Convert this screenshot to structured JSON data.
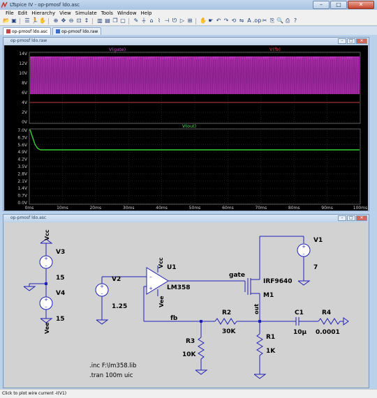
{
  "window": {
    "title": "LTspice IV - op-pmosf ldo.asc",
    "minimize": "–",
    "maximize": "□",
    "close": "✕"
  },
  "menu": [
    "File",
    "Edit",
    "Hierarchy",
    "View",
    "Simulate",
    "Tools",
    "Window",
    "Help"
  ],
  "toolbar_icons": [
    "open-icon",
    "save-icon",
    "control-panel-icon",
    "run-icon",
    "halt-icon",
    "zoom-in-icon",
    "pan-icon",
    "zoom-out-icon",
    "zoom-full-icon",
    "autorange-icon",
    "tile-vert-icon",
    "tile-horiz-icon",
    "cascade-icon",
    "close-window-icon",
    "wire-icon",
    "ground-icon",
    "label-icon",
    "resistor-icon",
    "capacitor-icon",
    "inductor-icon",
    "diode-icon",
    "component-icon",
    "move-icon",
    "drag-icon",
    "undo-icon",
    "redo-icon",
    "rotate-icon",
    "mirror-icon",
    "text-icon",
    "spice-directive-icon",
    "delete-icon",
    "duplicate-icon",
    "find-icon",
    "print-icon",
    "help-icon"
  ],
  "tabs": [
    {
      "label": "op-pmosf ldo.asc",
      "active": true
    },
    {
      "label": "op-pmosf ldo.raw",
      "active": false
    }
  ],
  "waveform_window": {
    "title": "op-pmosf ldo.raw",
    "top_pane": {
      "traces": [
        "V(gate)",
        "V(fb)"
      ],
      "y_ticks": [
        "14V",
        "12V",
        "10V",
        "8V",
        "6V",
        "4V",
        "2V",
        "0V"
      ],
      "trace_colors": {
        "gate": "#c433c4",
        "fb": "#c43a3a"
      }
    },
    "bottom_pane": {
      "traces": [
        "V(out)"
      ],
      "y_ticks": [
        "7.0V",
        "6.3V",
        "5.6V",
        "4.9V",
        "4.2V",
        "3.5V",
        "2.8V",
        "2.1V",
        "1.4V",
        "0.7V",
        "0.0V"
      ],
      "trace_colors": {
        "out": "#36d036"
      }
    },
    "x_ticks": [
      "0ms",
      "10ms",
      "20ms",
      "30ms",
      "40ms",
      "50ms",
      "60ms",
      "70ms",
      "80ms",
      "90ms",
      "100ms"
    ]
  },
  "schematic_window": {
    "title": "op-pmosf ldo.asc",
    "labels": {
      "v3": "V3",
      "v3_val": "15",
      "v4": "V4",
      "v4_val": "15",
      "vcc_top": "Vcc",
      "vee_bottom": "Vee",
      "v2": "V2",
      "v2_val": "1.25",
      "u1": "U1",
      "u1_part": "LM358",
      "u1_vcc": "Vcc",
      "u1_vee": "Vee",
      "v1": "V1",
      "v1_val": "7",
      "gate": "gate",
      "m1_part": "IRF9640",
      "m1": "M1",
      "fb": "fb",
      "r2": "R2",
      "r2_val": "30K",
      "r3": "R3",
      "r3_val": "10K",
      "out": "out",
      "r1": "R1",
      "r1_val": "1K",
      "c1": "C1",
      "c1_val": "10µ",
      "r4": "R4",
      "r4_val": "0.0001",
      "inc": ".inc F:\\lm358.lib",
      "tran": ".tran 100m uic"
    }
  },
  "status": "Click to plot wire current -I(V1)"
}
